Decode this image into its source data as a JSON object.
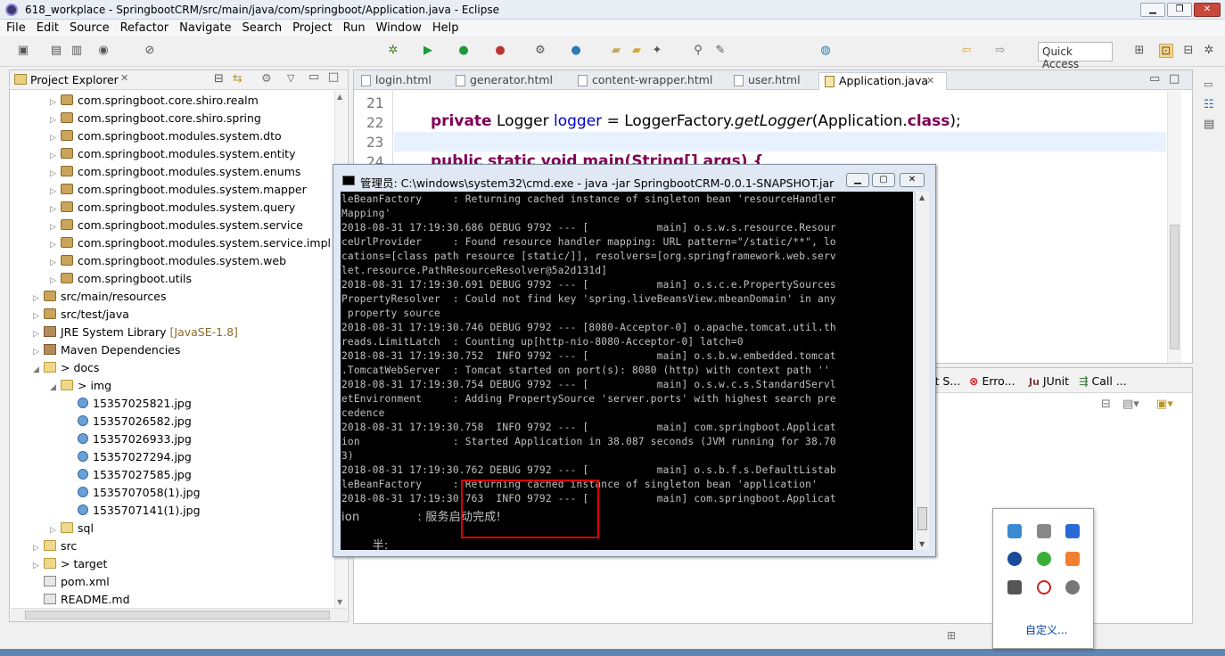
{
  "window": {
    "title": "618_workplace - SpringbootCRM/src/main/java/com/springboot/Application.java - Eclipse"
  },
  "menu": [
    "File",
    "Edit",
    "Source",
    "Refactor",
    "Navigate",
    "Search",
    "Project",
    "Run",
    "Window",
    "Help"
  ],
  "quick_access": "Quick Access",
  "explorer": {
    "title": "Project Explorer",
    "items": [
      {
        "label": "com.springboot.core.shiro.realm",
        "type": "pkg",
        "indent": 3,
        "toggle": "▷"
      },
      {
        "label": "com.springboot.core.shiro.spring",
        "type": "pkg",
        "indent": 3,
        "toggle": "▷"
      },
      {
        "label": "com.springboot.modules.system.dto",
        "type": "pkg",
        "indent": 3,
        "toggle": "▷"
      },
      {
        "label": "com.springboot.modules.system.entity",
        "type": "pkg",
        "indent": 3,
        "toggle": "▷"
      },
      {
        "label": "com.springboot.modules.system.enums",
        "type": "pkg",
        "indent": 3,
        "toggle": "▷"
      },
      {
        "label": "com.springboot.modules.system.mapper",
        "type": "pkg",
        "indent": 3,
        "toggle": "▷"
      },
      {
        "label": "com.springboot.modules.system.query",
        "type": "pkg",
        "indent": 3,
        "toggle": "▷"
      },
      {
        "label": "com.springboot.modules.system.service",
        "type": "pkg",
        "indent": 3,
        "toggle": "▷"
      },
      {
        "label": "com.springboot.modules.system.service.impl",
        "type": "pkg",
        "indent": 3,
        "toggle": "▷"
      },
      {
        "label": "com.springboot.modules.system.web",
        "type": "pkg",
        "indent": 3,
        "toggle": "▷"
      },
      {
        "label": "com.springboot.utils",
        "type": "pkg",
        "indent": 3,
        "toggle": "▷"
      },
      {
        "label": "src/main/resources",
        "type": "pkg",
        "indent": 2,
        "toggle": "▷"
      },
      {
        "label": "src/test/java",
        "type": "pkg",
        "indent": 2,
        "toggle": "▷"
      },
      {
        "label": "JRE System Library",
        "decor": "[JavaSE-1.8]",
        "type": "jar",
        "indent": 2,
        "toggle": "▷"
      },
      {
        "label": "Maven Dependencies",
        "type": "jar",
        "indent": 2,
        "toggle": "▷"
      },
      {
        "label": "> docs",
        "type": "fld",
        "indent": 2,
        "toggle": "◢"
      },
      {
        "label": "> img",
        "type": "fld",
        "indent": 3,
        "toggle": "◢"
      },
      {
        "label": "15357025821.jpg",
        "type": "jpg",
        "indent": 4,
        "toggle": ""
      },
      {
        "label": "15357026582.jpg",
        "type": "jpg",
        "indent": 4,
        "toggle": ""
      },
      {
        "label": "15357026933.jpg",
        "type": "jpg",
        "indent": 4,
        "toggle": ""
      },
      {
        "label": "15357027294.jpg",
        "type": "jpg",
        "indent": 4,
        "toggle": ""
      },
      {
        "label": "15357027585.jpg",
        "type": "jpg",
        "indent": 4,
        "toggle": ""
      },
      {
        "label": "1535707058(1).jpg",
        "type": "jpg",
        "indent": 4,
        "toggle": ""
      },
      {
        "label": "1535707141(1).jpg",
        "type": "jpg",
        "indent": 4,
        "toggle": ""
      },
      {
        "label": "sql",
        "type": "fld",
        "indent": 3,
        "toggle": "▷"
      },
      {
        "label": "src",
        "type": "fld",
        "indent": 2,
        "toggle": "▷"
      },
      {
        "label": "> target",
        "type": "fld",
        "indent": 2,
        "toggle": "▷"
      },
      {
        "label": "pom.xml",
        "type": "xml",
        "indent": 2,
        "toggle": ""
      },
      {
        "label": "README.md",
        "type": "xml",
        "indent": 2,
        "toggle": ""
      }
    ]
  },
  "editor": {
    "tabs": [
      {
        "label": "login.html",
        "active": false
      },
      {
        "label": "generator.html",
        "active": false
      },
      {
        "label": "content-wrapper.html",
        "active": false
      },
      {
        "label": "user.html",
        "active": false
      },
      {
        "label": "Application.java",
        "active": true
      }
    ],
    "line_numbers": [
      "21",
      "22",
      "23",
      "24"
    ],
    "code": {
      "l22_kw": "private",
      "l22_type": " Logger ",
      "l22_field": "logger",
      "l22_eq": " = LoggerFactory.",
      "l22_method": "getLogger",
      "l22_arg": "(Application.",
      "l22_class_kw": "class",
      "l22_end": ");",
      "l24": "public static void main(String[] args) {"
    }
  },
  "bottom_panel": {
    "tabs": [
      "it S...",
      "Erro...",
      "JUnit",
      "Call ..."
    ]
  },
  "cmd": {
    "title": "管理员: C:\\windows\\system32\\cmd.exe - java  -jar SpringbootCRM-0.0.1-SNAPSHOT.jar",
    "lines": [
      "leBeanFactory     : Returning cached instance of singleton bean 'resourceHandler",
      "Mapping'",
      "2018-08-31 17:19:30.686 DEBUG 9792 --- [           main] o.s.w.s.resource.Resour",
      "ceUrlProvider     : Found resource handler mapping: URL pattern=\"/static/**\", lo",
      "cations=[class path resource [static/]], resolvers=[org.springframework.web.serv",
      "let.resource.PathResourceResolver@5a2d131d]",
      "2018-08-31 17:19:30.691 DEBUG 9792 --- [           main] o.s.c.e.PropertySources",
      "PropertyResolver  : Could not find key 'spring.liveBeansView.mbeanDomain' in any",
      " property source",
      "2018-08-31 17:19:30.746 DEBUG 9792 --- [8080-Acceptor-0] o.apache.tomcat.util.th",
      "reads.LimitLatch  : Counting up[http-nio-8080-Acceptor-0] latch=0",
      "2018-08-31 17:19:30.752  INFO 9792 --- [           main] o.s.b.w.embedded.tomcat",
      ".TomcatWebServer  : Tomcat started on port(s): 8080 (http) with context path ''",
      "2018-08-31 17:19:30.754 DEBUG 9792 --- [           main] o.s.w.c.s.StandardServl",
      "etEnvironment     : Adding PropertySource 'server.ports' with highest search pre",
      "cedence",
      "2018-08-31 17:19:30.758  INFO 9792 --- [           main] com.springboot.Applicat",
      "ion               : Started Application in 38.087 seconds (JVM running for 38.70",
      "3)",
      "2018-08-31 17:19:30.762 DEBUG 9792 --- [           main] o.s.b.f.s.DefaultListab",
      "leBeanFactory     : Returning cached instance of singleton bean 'application'",
      "2018-08-31 17:19:30.763  INFO 9792 --- [           main] com.springboot.Applicat",
      "ion               : 服务启动完成!",
      "",
      "        半:"
    ]
  },
  "tray": {
    "customize": "自定义..."
  }
}
